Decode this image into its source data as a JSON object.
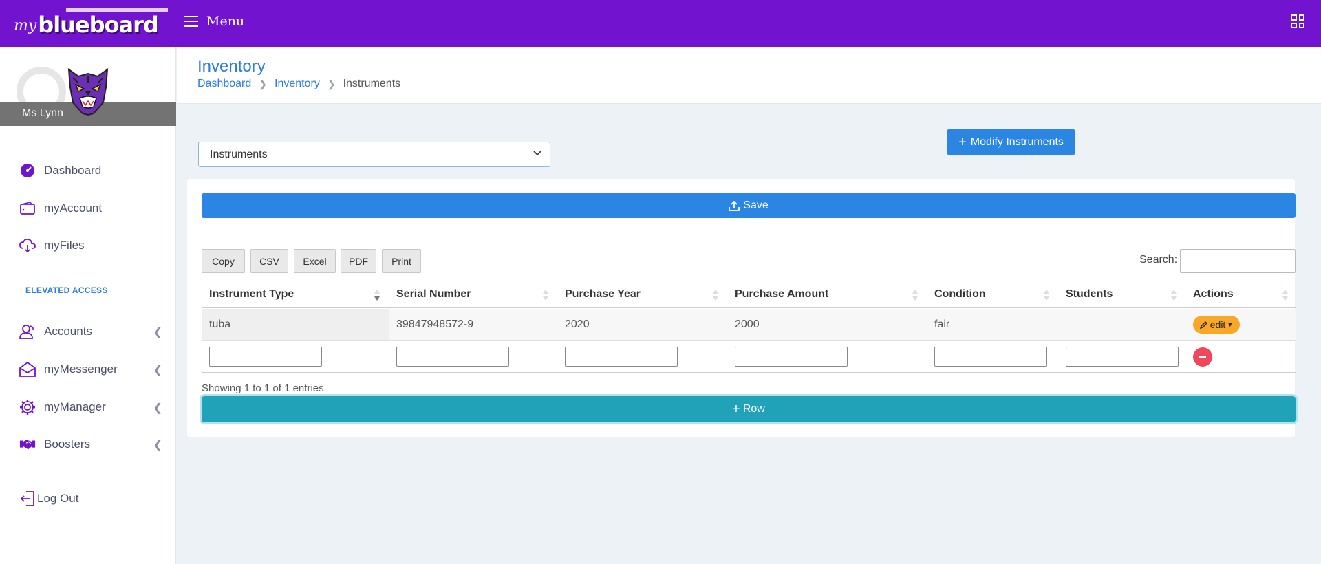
{
  "brand": {
    "my": "my",
    "name": "blueboard"
  },
  "topbar": {
    "menu_label": "Menu",
    "apps_icon": "grid-icon"
  },
  "profile": {
    "name": "Ms Lynn",
    "avatar": "tiger-mascot"
  },
  "sidebar": {
    "items": [
      {
        "label": "Dashboard",
        "icon": "dashboard-icon"
      },
      {
        "label": "myAccount",
        "icon": "wallet-icon"
      },
      {
        "label": "myFiles",
        "icon": "cloud-download-icon"
      }
    ],
    "section_label": "ELEVATED ACCESS",
    "elevated": [
      {
        "label": "Accounts",
        "icon": "users-icon"
      },
      {
        "label": "myMessenger",
        "icon": "envelope-icon"
      },
      {
        "label": "myManager",
        "icon": "gear-icon"
      },
      {
        "label": "Boosters",
        "icon": "handshake-icon"
      }
    ],
    "logout": "Log Out"
  },
  "header": {
    "title": "Inventory",
    "breadcrumb": [
      "Dashboard",
      "Inventory",
      "Instruments"
    ]
  },
  "controls": {
    "select_value": "Instruments",
    "modify_button": "Modify Instruments",
    "save_button": "Save"
  },
  "table": {
    "export_buttons": [
      "Copy",
      "CSV",
      "Excel",
      "PDF",
      "Print"
    ],
    "search_label": "Search:",
    "columns": [
      "Instrument Type",
      "Serial Number",
      "Purchase Year",
      "Purchase Amount",
      "Condition",
      "Students",
      "Actions"
    ],
    "rows": [
      {
        "instrument_type": "tuba",
        "serial_number": "39847948572-9",
        "purchase_year": "2020",
        "purchase_amount": "2000",
        "condition": "fair",
        "students": "",
        "action_label": "edit"
      }
    ],
    "info": "Showing 1 to 1 of 1 entries",
    "add_row_button": "Row"
  },
  "colors": {
    "topbar": "#7113cf",
    "primary": "#2a86e2",
    "accent_teal": "#20a2b8",
    "edit": "#f8a826",
    "remove": "#f0475f"
  }
}
